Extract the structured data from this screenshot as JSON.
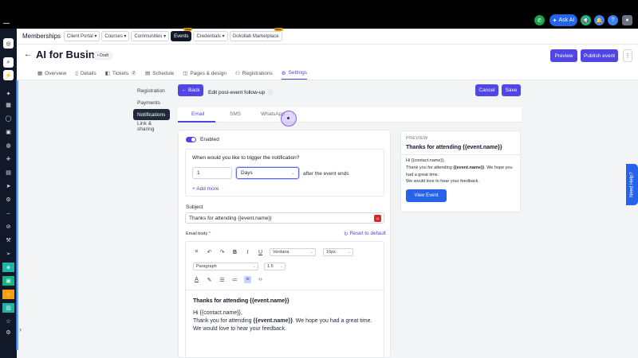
{
  "topbar": {
    "ask_ai": "Ask AI",
    "icons": [
      "phone-icon",
      "sparkle-icon",
      "megaphone-icon",
      "bell-icon",
      "help-icon",
      "avatar"
    ]
  },
  "breadcrumb": {
    "title": "Memberships",
    "items": [
      {
        "label": "Client Portal",
        "has_dropdown": true
      },
      {
        "label": "Courses",
        "has_dropdown": true
      },
      {
        "label": "Communities",
        "has_dropdown": true
      },
      {
        "label": "Events",
        "badge": "Beta",
        "active": true
      },
      {
        "label": "Credentials",
        "has_dropdown": true
      },
      {
        "label": "Gokollab Marketplace",
        "badge": "New"
      }
    ]
  },
  "header": {
    "title": "AI for Business",
    "status": "Draft",
    "preview_label": "Preview",
    "publish_label": "Publish event"
  },
  "tabs": [
    {
      "label": "Overview",
      "icon": "grid-icon"
    },
    {
      "label": "Details",
      "icon": "file-icon"
    },
    {
      "label": "Tickets",
      "icon": "ticket-icon",
      "count": "2"
    },
    {
      "label": "Schedule",
      "icon": "calendar-icon"
    },
    {
      "label": "Pages & design",
      "icon": "layout-icon"
    },
    {
      "label": "Registrations",
      "icon": "users-icon"
    },
    {
      "label": "Settings",
      "icon": "gear-icon",
      "active": true
    }
  ],
  "settings_nav": [
    {
      "label": "Registration"
    },
    {
      "label": "Payments"
    },
    {
      "label": "Notifications",
      "active": true
    },
    {
      "label": "Link & sharing"
    }
  ],
  "editbar": {
    "back_label": "Back",
    "title": "Edit post-event follow-up",
    "cancel_label": "Cancel",
    "save_label": "Save"
  },
  "channel_tabs": [
    {
      "label": "Email",
      "active": true
    },
    {
      "label": "SMS"
    },
    {
      "label": "WhatsApp"
    }
  ],
  "notification": {
    "enabled_label": "Enabled",
    "enabled": true,
    "trigger_question": "When would you like to trigger the notification?",
    "amount": "1",
    "unit": "Days",
    "after_text": "after the event ends",
    "add_more": "+ Add more",
    "subject_label": "Subject",
    "subject_value": "Thanks for attending {{event.name}}",
    "body_label": "Email body",
    "required_mark": "*",
    "reset_label": "Reset to default"
  },
  "editor": {
    "font": "Verdana",
    "size": "16px",
    "block": "Paragraph",
    "line_height": "1.5",
    "heading": "Thanks for attending {{event.name}}",
    "line1": "Hi {{contact.name}},",
    "line2_prefix": "Thank you for attending ",
    "line2_var": "{{event.name}}",
    "line2_suffix": ". We hope you had a great time.",
    "line3": "We would love to hear your feedback."
  },
  "preview": {
    "label": "PREVIEW",
    "title": "Thanks for attending {{event.name}}",
    "greeting": "Hi {{contact.name}},",
    "line_prefix": "Thank you for attending ",
    "line_var": "{{event.name}}",
    "line_suffix": ". We hope you had a great time.",
    "feedback": "We would love to hear your feedback.",
    "button": "View Event"
  },
  "need_help": "Need Help?",
  "colors": {
    "accent": "#4f46e5",
    "link": "#2563eb",
    "topbar": "#000000"
  }
}
